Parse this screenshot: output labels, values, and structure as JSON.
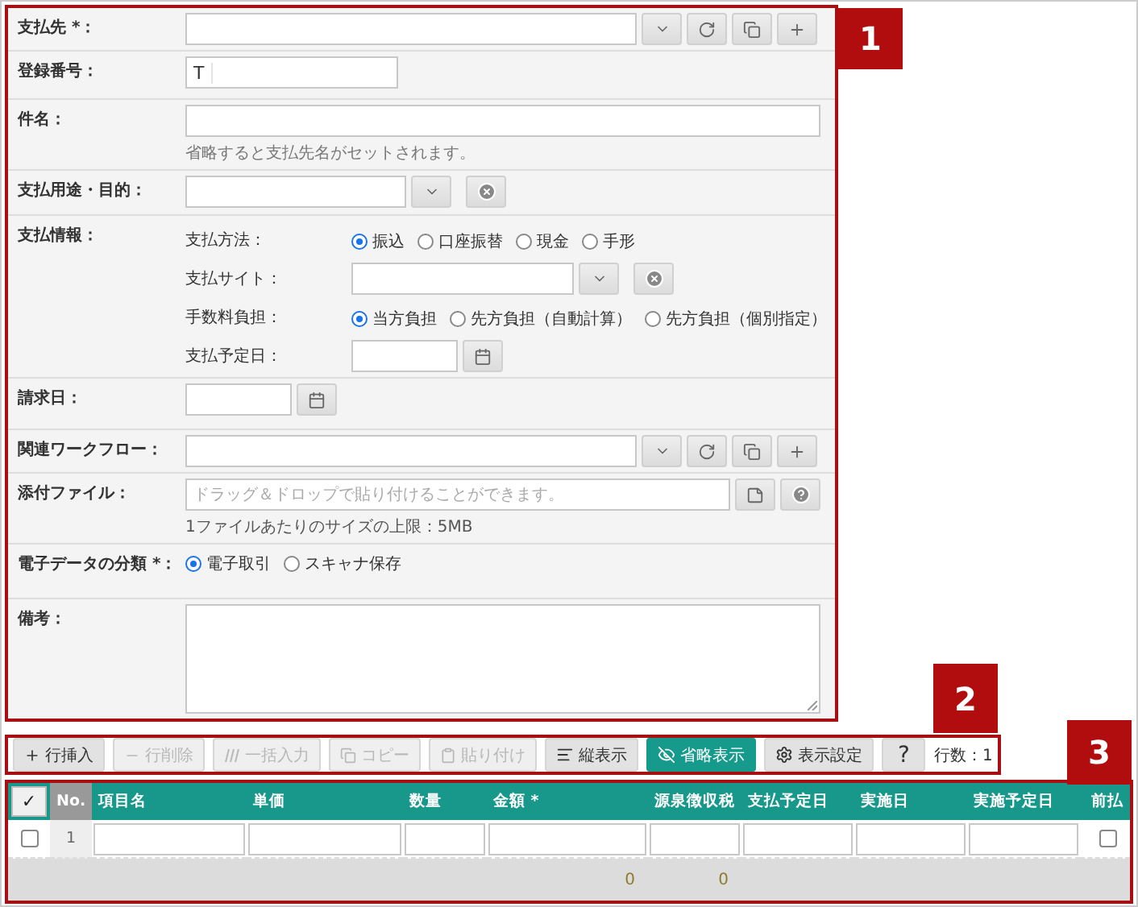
{
  "form": {
    "rows": [
      {
        "kind": "lookup",
        "label": "支払先 *："
      },
      {
        "kind": "prefixed",
        "label": "登録番号：",
        "prefix": "T"
      },
      {
        "kind": "text",
        "label": "件名：",
        "hint": "省略すると支払先名がセットされます。"
      },
      {
        "kind": "select",
        "label": "支払用途・目的："
      },
      {
        "kind": "group",
        "label": "支払情報：",
        "fields": [
          {
            "kind": "radio",
            "label": "支払方法：",
            "options": [
              {
                "label": "振込",
                "selected": true
              },
              {
                "label": "口座振替",
                "selected": false
              },
              {
                "label": "現金",
                "selected": false
              },
              {
                "label": "手形",
                "selected": false
              }
            ]
          },
          {
            "kind": "select",
            "label": "支払サイト："
          },
          {
            "kind": "radio",
            "label": "手数料負担：",
            "options": [
              {
                "label": "当方負担",
                "selected": true
              },
              {
                "label": "先方負担（自動計算）",
                "selected": false
              },
              {
                "label": "先方負担（個別指定）",
                "selected": false
              }
            ]
          },
          {
            "kind": "date",
            "label": "支払予定日："
          }
        ]
      },
      {
        "kind": "date",
        "label": "請求日："
      },
      {
        "kind": "lookup",
        "label": "関連ワークフロー："
      },
      {
        "kind": "attach",
        "label": "添付ファイル：",
        "placeholder": "ドラッグ＆ドロップで貼り付けることができます。",
        "hint": "1ファイルあたりのサイズの上限：5MB"
      },
      {
        "kind": "radio",
        "label": "電子データの分類 *：",
        "options": [
          {
            "label": "電子取引",
            "selected": true
          },
          {
            "label": "スキャナ保存",
            "selected": false
          }
        ]
      },
      {
        "kind": "textarea",
        "label": "備考："
      }
    ]
  },
  "toolbar": {
    "buttons": [
      {
        "kind": "insert",
        "label": "行挿入",
        "disabled": false,
        "on": false
      },
      {
        "kind": "delete",
        "label": "行削除",
        "disabled": true,
        "on": false
      },
      {
        "kind": "bulk",
        "label": "一括入力",
        "disabled": true,
        "on": false
      },
      {
        "kind": "copy",
        "label": "コピー",
        "disabled": true,
        "on": false
      },
      {
        "kind": "paste",
        "label": "貼り付け",
        "disabled": true,
        "on": false
      },
      {
        "kind": "vertical",
        "label": "縦表示",
        "disabled": false,
        "on": false
      },
      {
        "kind": "compact",
        "label": "省略表示",
        "disabled": false,
        "on": true
      },
      {
        "kind": "settings",
        "label": "表示設定",
        "disabled": false,
        "on": false
      },
      {
        "kind": "help",
        "label": "?",
        "disabled": false,
        "on": false
      }
    ],
    "row_count": "行数：1"
  },
  "table": {
    "select_all": "✓",
    "no_header": "No.",
    "columns": [
      {
        "kind": "input",
        "label": "項目名"
      },
      {
        "kind": "input",
        "label": "単価"
      },
      {
        "kind": "input",
        "label": "数量"
      },
      {
        "kind": "input",
        "label": "金額 *",
        "total": "0"
      },
      {
        "kind": "input",
        "label": "源泉徴収税",
        "total": "0"
      },
      {
        "kind": "input",
        "label": "支払予定日"
      },
      {
        "kind": "input",
        "label": "実施日"
      },
      {
        "kind": "input",
        "label": "実施予定日"
      },
      {
        "kind": "check",
        "label": "前払"
      }
    ],
    "rows": [
      {
        "no": "1",
        "checked": false,
        "prepaid": false
      }
    ]
  },
  "callouts": [
    {
      "label": "1"
    },
    {
      "label": "2"
    },
    {
      "label": "3"
    }
  ]
}
